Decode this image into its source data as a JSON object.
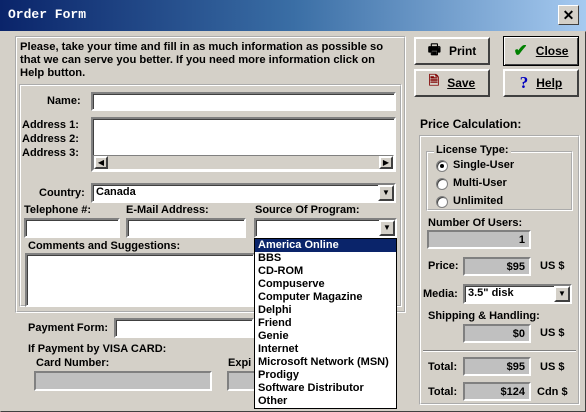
{
  "window": {
    "title": "Order Form",
    "close_glyph": "✕"
  },
  "intro": "Please, take your time and fill in as much information as possible so that we can serve you better. If you need more information click on Help button.",
  "form": {
    "name_label": "Name:",
    "address_labels": [
      "Address 1:",
      "Address 2:",
      "Address 3:"
    ],
    "country_label": "Country:",
    "country_value": "Canada",
    "telephone_label": "Telephone #:",
    "email_label": "E-Mail Address:",
    "source_label": "Source Of Program:",
    "comments_label": "Comments and Suggestions:",
    "payment_label": "Payment Form:",
    "visa_label": "If Payment by VISA CARD:",
    "card_number_label": "Card Number:",
    "expiry_label": "Expi"
  },
  "source_options": [
    "America Online",
    "BBS",
    "CD-ROM",
    "Compuserve",
    "Computer Magazine",
    "Delphi",
    "Friend",
    "Genie",
    "Internet",
    "Microsoft Network (MSN)",
    "Prodigy",
    "Software Distributor",
    "Other"
  ],
  "source_selected_index": 0,
  "buttons": {
    "print": "Print",
    "close": "Close",
    "save": "Save",
    "help": "Help"
  },
  "price": {
    "heading": "Price Calculation:",
    "license_label": "License Type:",
    "license_options": [
      "Single-User",
      "Multi-User",
      "Unlimited"
    ],
    "license_selected_index": 0,
    "users_label": "Number Of Users:",
    "users_value": "1",
    "price_label": "Price:",
    "price_value": "$95",
    "price_unit": "US $",
    "media_label": "Media:",
    "media_value": "3.5\" disk",
    "shipping_label": "Shipping & Handling:",
    "shipping_value": "$0",
    "shipping_unit": "US $",
    "total_label": "Total:",
    "total_us_value": "$95",
    "total_us_unit": "US $",
    "total_cdn_value": "$124",
    "total_cdn_unit": "Cdn $"
  }
}
